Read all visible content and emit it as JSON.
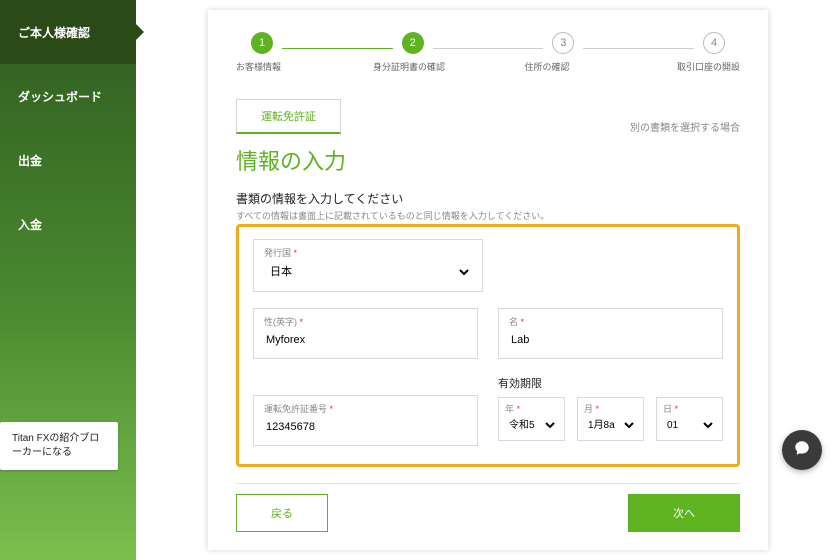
{
  "sidebar": {
    "items": [
      {
        "label": "ご本人様確認",
        "active": true
      },
      {
        "label": "ダッシュボード",
        "active": false
      },
      {
        "label": "出金",
        "active": false
      },
      {
        "label": "入金",
        "active": false
      }
    ],
    "broker_box": "Titan FXの紹介ブローカーになる"
  },
  "stepper": {
    "steps": [
      {
        "num": "1",
        "label": "お客様情報",
        "done": true
      },
      {
        "num": "2",
        "label": "身分証明書の確認",
        "done": true
      },
      {
        "num": "3",
        "label": "住所の確認",
        "done": false
      },
      {
        "num": "4",
        "label": "取引口座の開設",
        "done": false
      }
    ]
  },
  "tab": {
    "label": "運転免許証"
  },
  "alt_link": "別の書類を選択する場合",
  "section_title": "情報の入力",
  "sub_title": "書類の情報を入力してください",
  "sub_note": "すべての情報は書面上に記載されているものと同じ情報を入力してください。",
  "form": {
    "country": {
      "label": "発行国",
      "value": "日本"
    },
    "last_name": {
      "label": "性(英字)",
      "value": "Myforex"
    },
    "first_name": {
      "label": "名",
      "value": "Lab"
    },
    "license_no": {
      "label": "運転免許証番号",
      "value": "12345678"
    },
    "expiry": {
      "heading": "有効期限",
      "year": {
        "label": "年",
        "value": "令和5"
      },
      "month": {
        "label": "月",
        "value": "1月8a"
      },
      "day": {
        "label": "日",
        "value": "01"
      }
    }
  },
  "buttons": {
    "back": "戻る",
    "next": "次へ"
  },
  "required_mark": "*"
}
